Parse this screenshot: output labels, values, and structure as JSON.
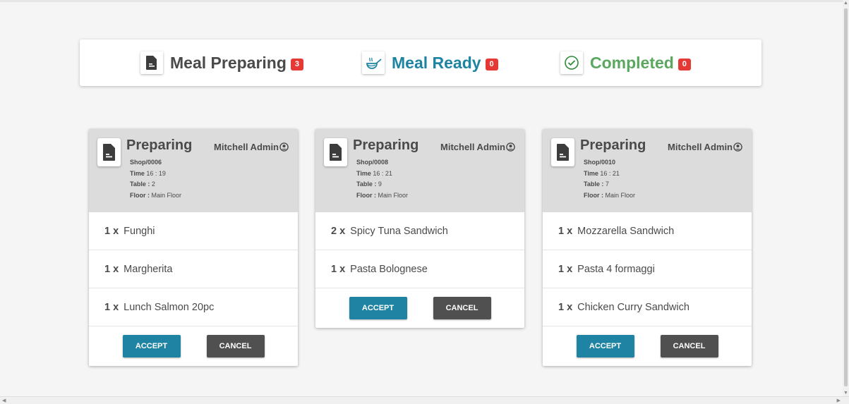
{
  "status_tabs": [
    {
      "label": "Meal Preparing",
      "count": "3",
      "icon": "document-icon"
    },
    {
      "label": "Meal Ready",
      "count": "0",
      "icon": "cooking-pan-icon"
    },
    {
      "label": "Completed",
      "count": "0",
      "icon": "check-circle-icon"
    }
  ],
  "orders": [
    {
      "status": "Preparing",
      "user": "Mitchell Admin",
      "ref": "Shop/0006",
      "time_label": "Time",
      "time": "16 : 19",
      "table_label": "Table :",
      "table": "2",
      "floor_label": "Floor :",
      "floor": "Main Floor",
      "lines": [
        {
          "qty": "1 x",
          "product": "Funghi"
        },
        {
          "qty": "1 x",
          "product": "Margherita"
        },
        {
          "qty": "1 x",
          "product": "Lunch Salmon 20pc"
        }
      ]
    },
    {
      "status": "Preparing",
      "user": "Mitchell Admin",
      "ref": "Shop/0008",
      "time_label": "Time",
      "time": "16 : 21",
      "table_label": "Table :",
      "table": "9",
      "floor_label": "Floor :",
      "floor": "Main Floor",
      "lines": [
        {
          "qty": "2 x",
          "product": "Spicy Tuna Sandwich"
        },
        {
          "qty": "1 x",
          "product": "Pasta Bolognese"
        }
      ]
    },
    {
      "status": "Preparing",
      "user": "Mitchell Admin",
      "ref": "Shop/0010",
      "time_label": "Time",
      "time": "16 : 21",
      "table_label": "Table :",
      "table": "7",
      "floor_label": "Floor :",
      "floor": "Main Floor",
      "lines": [
        {
          "qty": "1 x",
          "product": "Mozzarella Sandwich"
        },
        {
          "qty": "1 x",
          "product": "Pasta 4 formaggi"
        },
        {
          "qty": "1 x",
          "product": "Chicken Curry Sandwich"
        }
      ]
    }
  ],
  "actions": {
    "accept_label": "ACCEPT",
    "cancel_label": "CANCEL"
  },
  "colors": {
    "accent": "#1f84a3",
    "completed": "#5aa860",
    "badge": "#e53935",
    "cancel": "#505050"
  }
}
